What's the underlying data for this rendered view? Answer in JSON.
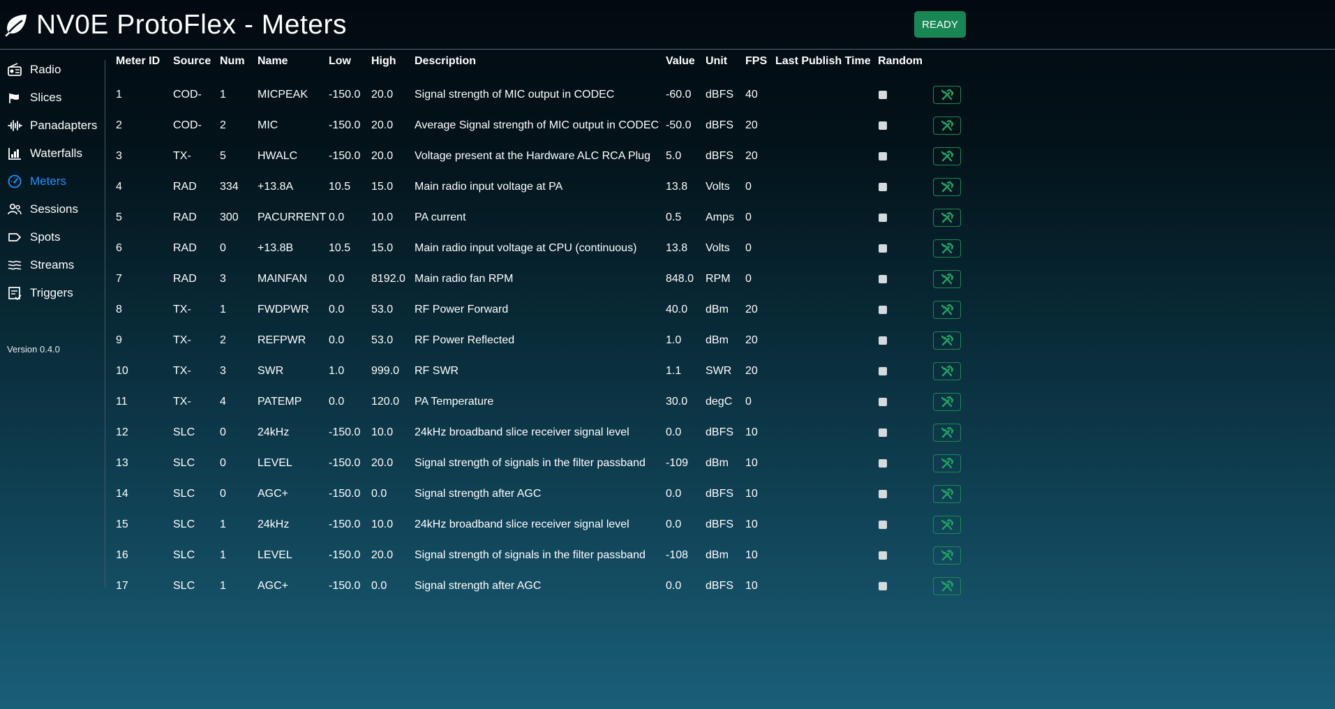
{
  "header": {
    "title": "NV0E  ProtoFlex - Meters",
    "status_button": "READY"
  },
  "sidebar": {
    "items": [
      {
        "label": "Radio",
        "icon": "radio-icon"
      },
      {
        "label": "Slices",
        "icon": "flag-icon"
      },
      {
        "label": "Panadapters",
        "icon": "waveform-icon"
      },
      {
        "label": "Waterfalls",
        "icon": "bar-chart-icon"
      },
      {
        "label": "Meters",
        "icon": "speedometer-icon",
        "active": true
      },
      {
        "label": "Sessions",
        "icon": "people-icon"
      },
      {
        "label": "Spots",
        "icon": "tag-icon"
      },
      {
        "label": "Streams",
        "icon": "water-icon"
      },
      {
        "label": "Triggers",
        "icon": "list-check-icon"
      }
    ],
    "version": "Version 0.4.0"
  },
  "table": {
    "headers": [
      "Meter ID",
      "Source",
      "Num",
      "Name",
      "Low",
      "High",
      "Description",
      "Value",
      "Unit",
      "FPS",
      "Last Publish Time",
      "Random"
    ],
    "rows": [
      {
        "id": "1",
        "source": "COD-",
        "num": "1",
        "name": "MICPEAK",
        "low": "-150.0",
        "high": "20.0",
        "description": "Signal strength of MIC output in CODEC",
        "value": "-60.0",
        "unit": "dBFS",
        "fps": "40",
        "last_publish": ""
      },
      {
        "id": "2",
        "source": "COD-",
        "num": "2",
        "name": "MIC",
        "low": "-150.0",
        "high": "20.0",
        "description": "Average Signal strength of MIC output in CODEC",
        "value": "-50.0",
        "unit": "dBFS",
        "fps": "20",
        "last_publish": ""
      },
      {
        "id": "3",
        "source": "TX-",
        "num": "5",
        "name": "HWALC",
        "low": "-150.0",
        "high": "20.0",
        "description": "Voltage present at the Hardware ALC RCA Plug",
        "value": "5.0",
        "unit": "dBFS",
        "fps": "20",
        "last_publish": ""
      },
      {
        "id": "4",
        "source": "RAD",
        "num": "334",
        "name": "+13.8A",
        "low": "10.5",
        "high": "15.0",
        "description": "Main radio input voltage at PA",
        "value": "13.8",
        "unit": "Volts",
        "fps": "0",
        "last_publish": ""
      },
      {
        "id": "5",
        "source": "RAD",
        "num": "300",
        "name": "PACURRENT",
        "low": "0.0",
        "high": "10.0",
        "description": "PA current",
        "value": "0.5",
        "unit": "Amps",
        "fps": "0",
        "last_publish": ""
      },
      {
        "id": "6",
        "source": "RAD",
        "num": "0",
        "name": "+13.8B",
        "low": "10.5",
        "high": "15.0",
        "description": "Main radio input voltage at CPU (continuous)",
        "value": "13.8",
        "unit": "Volts",
        "fps": "0",
        "last_publish": ""
      },
      {
        "id": "7",
        "source": "RAD",
        "num": "3",
        "name": "MAINFAN",
        "low": "0.0",
        "high": "8192.0",
        "description": "Main radio fan RPM",
        "value": "848.0",
        "unit": "RPM",
        "fps": "0",
        "last_publish": ""
      },
      {
        "id": "8",
        "source": "TX-",
        "num": "1",
        "name": "FWDPWR",
        "low": "0.0",
        "high": "53.0",
        "description": "RF Power Forward",
        "value": "40.0",
        "unit": "dBm",
        "fps": "20",
        "last_publish": ""
      },
      {
        "id": "9",
        "source": "TX-",
        "num": "2",
        "name": "REFPWR",
        "low": "0.0",
        "high": "53.0",
        "description": "RF Power Reflected",
        "value": "1.0",
        "unit": "dBm",
        "fps": "20",
        "last_publish": ""
      },
      {
        "id": "10",
        "source": "TX-",
        "num": "3",
        "name": "SWR",
        "low": "1.0",
        "high": "999.0",
        "description": "RF SWR",
        "value": "1.1",
        "unit": "SWR",
        "fps": "20",
        "last_publish": ""
      },
      {
        "id": "11",
        "source": "TX-",
        "num": "4",
        "name": "PATEMP",
        "low": "0.0",
        "high": "120.0",
        "description": "PA Temperature",
        "value": "30.0",
        "unit": "degC",
        "fps": "0",
        "last_publish": ""
      },
      {
        "id": "12",
        "source": "SLC",
        "num": "0",
        "name": "24kHz",
        "low": "-150.0",
        "high": "10.0",
        "description": "24kHz broadband slice receiver signal level",
        "value": "0.0",
        "unit": "dBFS",
        "fps": "10",
        "last_publish": ""
      },
      {
        "id": "13",
        "source": "SLC",
        "num": "0",
        "name": "LEVEL",
        "low": "-150.0",
        "high": "20.0",
        "description": "Signal strength of signals in the filter passband",
        "value": "-109",
        "unit": "dBm",
        "fps": "10",
        "last_publish": ""
      },
      {
        "id": "14",
        "source": "SLC",
        "num": "0",
        "name": "AGC+",
        "low": "-150.0",
        "high": "0.0",
        "description": "Signal strength after AGC",
        "value": "0.0",
        "unit": "dBFS",
        "fps": "10",
        "last_publish": ""
      },
      {
        "id": "15",
        "source": "SLC",
        "num": "1",
        "name": "24kHz",
        "low": "-150.0",
        "high": "10.0",
        "description": "24kHz broadband slice receiver signal level",
        "value": "0.0",
        "unit": "dBFS",
        "fps": "10",
        "last_publish": ""
      },
      {
        "id": "16",
        "source": "SLC",
        "num": "1",
        "name": "LEVEL",
        "low": "-150.0",
        "high": "20.0",
        "description": "Signal strength of signals in the filter passband",
        "value": "-108",
        "unit": "dBm",
        "fps": "10",
        "last_publish": ""
      },
      {
        "id": "17",
        "source": "SLC",
        "num": "1",
        "name": "AGC+",
        "low": "-150.0",
        "high": "0.0",
        "description": "Signal strength after AGC",
        "value": "0.0",
        "unit": "dBFS",
        "fps": "10",
        "last_publish": ""
      }
    ]
  },
  "colors": {
    "accent_active": "#1e90ff",
    "ready_green": "#198754",
    "tool_green": "#1d8a52"
  }
}
